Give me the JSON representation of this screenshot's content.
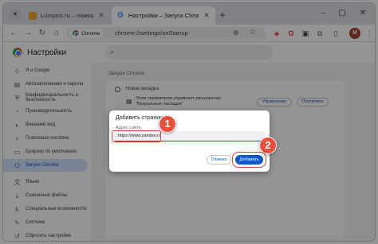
{
  "tabs": [
    {
      "title": "Lumpics.ru – помощь с компь",
      "active": false
    },
    {
      "title": "Настройки – Запуск Chrome",
      "active": true
    }
  ],
  "toolbar": {
    "chip_label": "Chrome",
    "url": "chrome://settings/onStartup",
    "avatar_letter": "M"
  },
  "settings": {
    "title": "Настройки",
    "sidebar": [
      {
        "label": "Я и Google",
        "icon": "person-icon"
      },
      {
        "label": "Автозаполнение и пароли",
        "icon": "autofill-icon"
      },
      {
        "label": "Конфиденциальность и безопасность",
        "icon": "shield-icon"
      },
      {
        "label": "Производительность",
        "icon": "speedometer-icon"
      },
      {
        "label": "Внешний вид",
        "icon": "palette-icon"
      },
      {
        "label": "Поисковая система",
        "icon": "search-icon"
      },
      {
        "label": "Браузер по умолчанию",
        "icon": "browser-icon"
      },
      {
        "label": "Запуск Chrome",
        "icon": "power-icon",
        "active": true
      },
      {
        "label": "Языки",
        "icon": "language-icon"
      },
      {
        "label": "Скачанные файлы",
        "icon": "download-icon"
      },
      {
        "label": "Специальные возможности",
        "icon": "accessibility-icon"
      },
      {
        "label": "Система",
        "icon": "wrench-icon"
      },
      {
        "label": "Сбросить настройки",
        "icon": "reset-icon"
      }
    ],
    "section_title": "Запуск Chrome",
    "option_new_tab": "Новая вкладка",
    "extension_note": "Этим параметром управляет расширение \"Визуальные закладки\"",
    "manage_button": "Управление",
    "disable_button": "Отключить"
  },
  "dialog": {
    "title": "Добавить страницу",
    "field_label": "Адрес сайта",
    "field_value": "https://www.yandex.ru",
    "cancel_label": "Отмена",
    "add_label": "Добавить"
  },
  "annotations": {
    "step1": "1",
    "step2": "2",
    "highlight_color": "#e33b2e",
    "badge_color": "#e8503c"
  }
}
